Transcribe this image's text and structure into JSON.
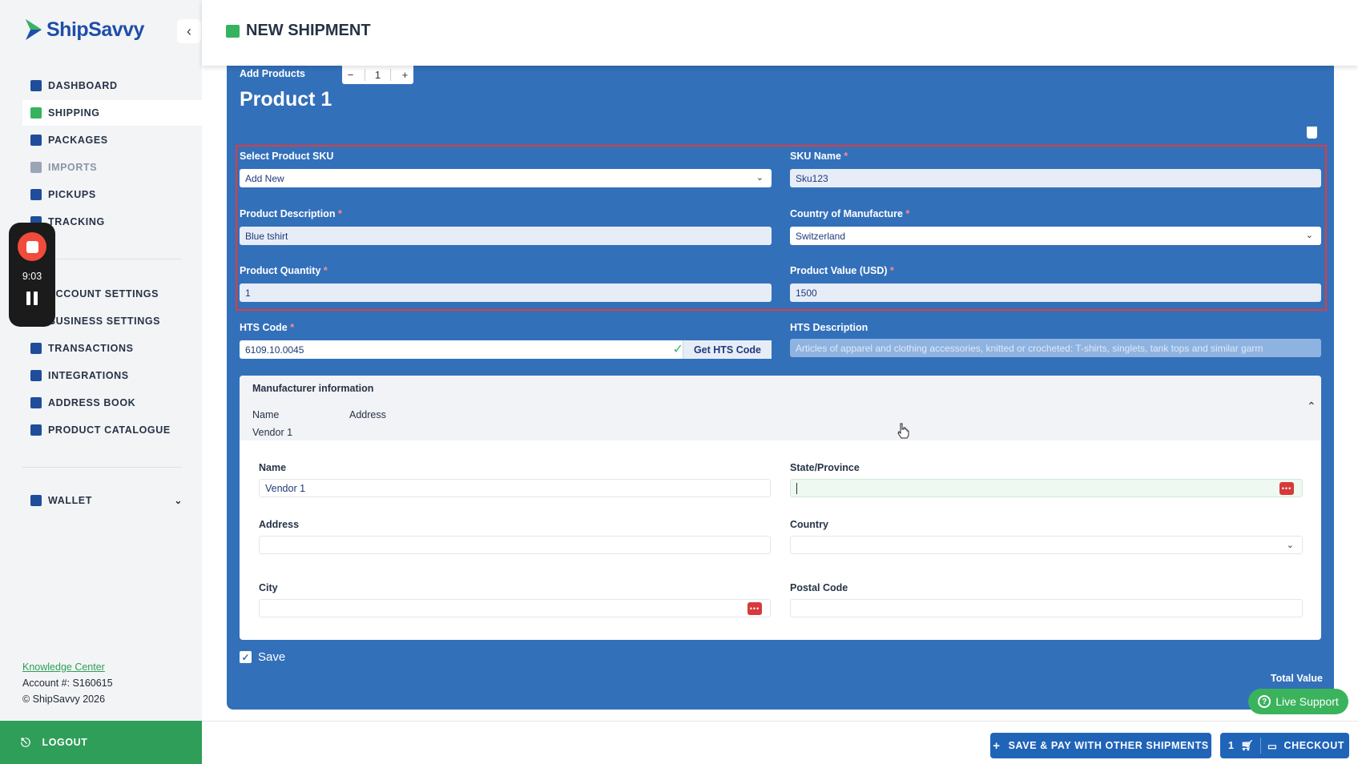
{
  "brand": {
    "name": "ShipSavvy"
  },
  "header": {
    "title": "NEW SHIPMENT"
  },
  "sidebar": {
    "items": [
      {
        "label": "DASHBOARD",
        "icon": "home-icon"
      },
      {
        "label": "SHIPPING",
        "icon": "shipping-box-icon",
        "active": true
      },
      {
        "label": "PACKAGES",
        "icon": "packages-icon"
      },
      {
        "label": "IMPORTS",
        "icon": "imports-icon"
      },
      {
        "label": "PICKUPS",
        "icon": "pickups-icon"
      },
      {
        "label": "TRACKING",
        "icon": "tracking-icon"
      },
      {
        "label": "ACCOUNT SETTINGS",
        "icon": "account-settings-icon"
      },
      {
        "label": "BUSINESS SETTINGS",
        "icon": "business-settings-icon"
      },
      {
        "label": "TRANSACTIONS",
        "icon": "transactions-icon"
      },
      {
        "label": "INTEGRATIONS",
        "icon": "integrations-icon"
      },
      {
        "label": "ADDRESS BOOK",
        "icon": "address-book-icon"
      },
      {
        "label": "PRODUCT CATALOGUE",
        "icon": "product-catalogue-icon"
      }
    ],
    "wallet_label": "WALLET",
    "knowledge_center": "Knowledge Center",
    "account": "Account #: S160615",
    "copyright": "© ShipSavvy 2026",
    "logout": "LOGOUT"
  },
  "recorder": {
    "time": "9:03"
  },
  "product": {
    "add_products_label": "Add Products",
    "quantity_stepper": "1",
    "title": "Product 1",
    "sku_select": {
      "label": "Select Product SKU",
      "value": "Add New"
    },
    "sku_name": {
      "label": "SKU Name",
      "value": "Sku123"
    },
    "description": {
      "label": "Product Description",
      "value": "Blue tshirt"
    },
    "country_of_manufacture": {
      "label": "Country of Manufacture",
      "value": "Switzerland"
    },
    "quantity": {
      "label": "Product Quantity",
      "value": "1"
    },
    "value_usd": {
      "label": "Product Value (USD)",
      "value": "1500"
    },
    "hts_code": {
      "label": "HTS Code",
      "value": "6109.10.0045",
      "button": "Get HTS Code"
    },
    "hts_description": {
      "label": "HTS Description",
      "value": "Articles of apparel and clothing accessories, knitted or crocheted: T-shirts, singlets, tank tops and similar garm"
    }
  },
  "manufacturer": {
    "section_title": "Manufacturer information",
    "col_name": "Name",
    "col_address": "Address",
    "row_name": "Vendor 1",
    "name": {
      "label": "Name",
      "value": "Vendor 1"
    },
    "state": {
      "label": "State/Province",
      "value": ""
    },
    "address": {
      "label": "Address",
      "value": ""
    },
    "country": {
      "label": "Country",
      "value": ""
    },
    "city": {
      "label": "City",
      "value": ""
    },
    "postal": {
      "label": "Postal Code",
      "value": ""
    }
  },
  "save_label": "Save",
  "save_checked": true,
  "total_value_label": "Total Value",
  "live_support": "Live Support",
  "footer": {
    "save_pay": "SAVE & PAY WITH OTHER SHIPMENTS",
    "cart_count": "1",
    "checkout": "CHECKOUT"
  },
  "colors": {
    "brand_blue": "#3370ba",
    "accent_green": "#2f9e58",
    "highlight_red": "#e23b3b"
  }
}
